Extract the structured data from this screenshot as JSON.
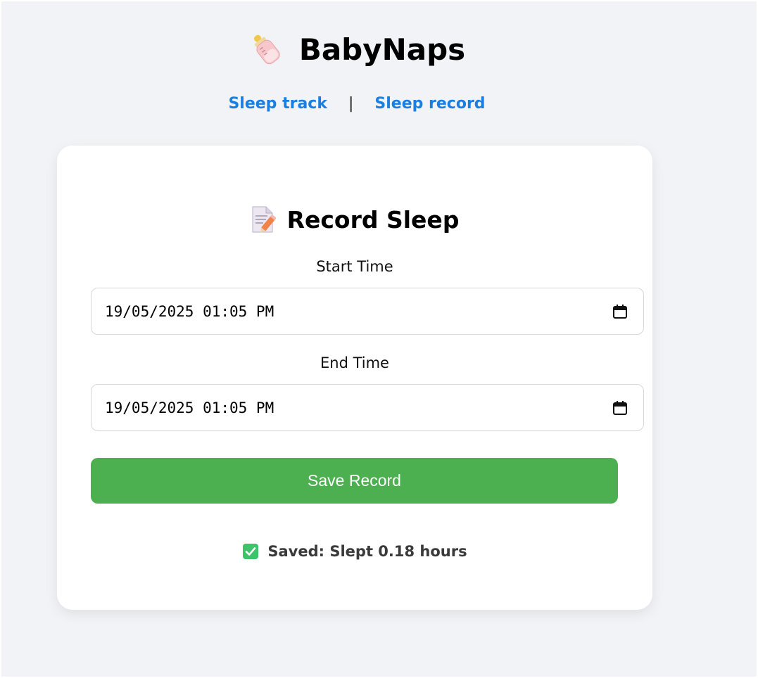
{
  "app": {
    "title": "BabyNaps",
    "logo_icon": "baby-bottle-icon"
  },
  "nav": {
    "items": [
      {
        "label": "Sleep track"
      },
      {
        "label": "Sleep record"
      }
    ],
    "separator": "|"
  },
  "form": {
    "title": "Record Sleep",
    "title_icon": "memo-icon",
    "start": {
      "label": "Start Time",
      "value": "19/05/2025 01:05 PM"
    },
    "end": {
      "label": "End Time",
      "value": "19/05/2025 01:05 PM"
    },
    "save_label": "Save Record",
    "status": {
      "icon": "check-mark-icon",
      "text": "Saved: Slept 0.18 hours"
    }
  },
  "colors": {
    "background": "#f2f3f6",
    "link": "#1a7fe0",
    "save_button": "#4caf50",
    "check": "#3ec26a"
  }
}
